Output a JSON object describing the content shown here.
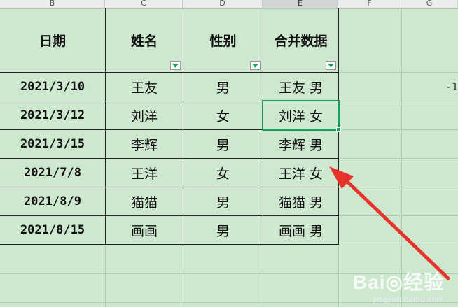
{
  "column_headers": [
    "B",
    "C",
    "D",
    "E",
    "F",
    "G"
  ],
  "table": {
    "headers": [
      "日期",
      "姓名",
      "性别",
      "合并数据"
    ],
    "rows": [
      [
        "2021/3/10",
        "王友",
        "男",
        "王友 男"
      ],
      [
        "2021/3/12",
        "刘洋",
        "女",
        "刘洋 女"
      ],
      [
        "2021/3/15",
        "李辉",
        "男",
        "李辉 男"
      ],
      [
        "2021/7/8",
        "王洋",
        "女",
        "王洋 女"
      ],
      [
        "2021/8/9",
        "猫猫",
        "男",
        "猫猫 男"
      ],
      [
        "2021/8/15",
        "画画",
        "男",
        "画画 男"
      ]
    ]
  },
  "offscreen_text": "-1",
  "selected_cell": "E",
  "watermark": {
    "brand": "Bai◎经验",
    "url": "jingyan.baidu.com"
  },
  "colors": {
    "background": "#cde8cf",
    "selection": "#1e9c55",
    "arrow": "#e8322a",
    "grid": "#aecfb2"
  },
  "icons": [
    "filter-dropdown-icon",
    "annotation-arrow-icon"
  ]
}
